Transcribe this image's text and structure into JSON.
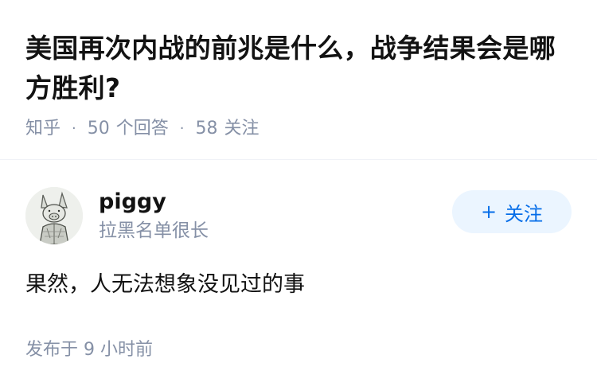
{
  "question": {
    "title": "美国再次内战的前兆是什么，战争结果会是哪方胜利?",
    "source": "知乎",
    "answer_count": "50",
    "answer_label": "个回答",
    "follow_count": "58",
    "follow_label": "关注"
  },
  "answer": {
    "author": {
      "name": "piggy",
      "bio": "拉黑名单很长",
      "avatar_icon": "pig-sketch-avatar-icon"
    },
    "follow_button": {
      "icon": "plus-icon",
      "plus": "+",
      "label": "关注"
    },
    "content": "果然，人无法想象没见过的事",
    "published": "发布于 9 小时前"
  },
  "colors": {
    "title": "#121212",
    "meta": "#8590a6",
    "follow_bg": "#ebf5ff",
    "follow_text": "#056de8",
    "divider": "#f0f2f7"
  }
}
